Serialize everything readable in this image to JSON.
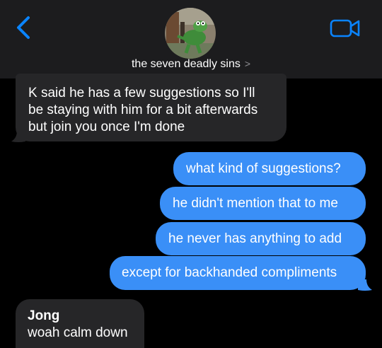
{
  "header": {
    "group_name": "the seven deadly sins",
    "chevron": ">",
    "back_icon": "chevron-left-icon",
    "video_icon": "video-camera-icon",
    "accent_color": "#0a84ff"
  },
  "messages": [
    {
      "direction": "received",
      "lines": [
        "K said he has a few suggestions so I'll",
        "be staying with him for a bit afterwards",
        "but join you once I'm done"
      ]
    },
    {
      "direction": "sent",
      "text": "what kind of suggestions?"
    },
    {
      "direction": "sent",
      "text": "he didn't mention that to me"
    },
    {
      "direction": "sent",
      "text": "he never has anything to add"
    },
    {
      "direction": "sent",
      "text": "except for backhanded compliments"
    },
    {
      "direction": "received",
      "sender": "Jong",
      "text": "woah calm down"
    }
  ],
  "colors": {
    "sent_bubble": "#3a8ff7",
    "received_bubble": "#262628",
    "header_bg": "#1c1c1e"
  }
}
